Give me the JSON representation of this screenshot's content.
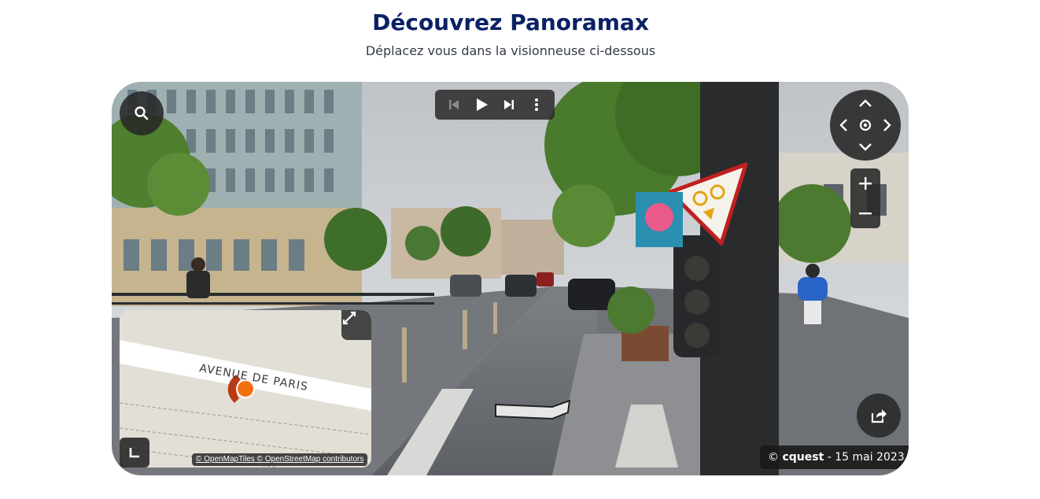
{
  "header": {
    "title": "Découvrez Panoramax",
    "subtitle": "Déplacez vous dans la visionneuse ci-dessous"
  },
  "viewer": {
    "controls": {
      "search_icon": "search-icon",
      "sequence_toolbar": [
        "skip-previous-icon",
        "play-icon",
        "skip-next-icon",
        "more-vertical-icon"
      ],
      "navigation": [
        "chevron-up-icon",
        "chevron-down-icon",
        "chevron-left-icon",
        "chevron-right-icon",
        "target-icon"
      ],
      "zoom": [
        "plus-icon",
        "minus-icon"
      ],
      "share_icon": "share-icon"
    },
    "minimap": {
      "street_label": "AVENUE DE PARIS",
      "attribution": "© OpenMapTiles © OpenStreetMap contributors",
      "marker_color": "#f07010",
      "heading_color": "#b83a14"
    },
    "credit": {
      "copyright": "©",
      "author": "cquest",
      "date": "- 15 mai 2023"
    }
  },
  "colors": {
    "title": "#0a2165",
    "subtitle": "#333a48",
    "control_bg": "#282828"
  }
}
